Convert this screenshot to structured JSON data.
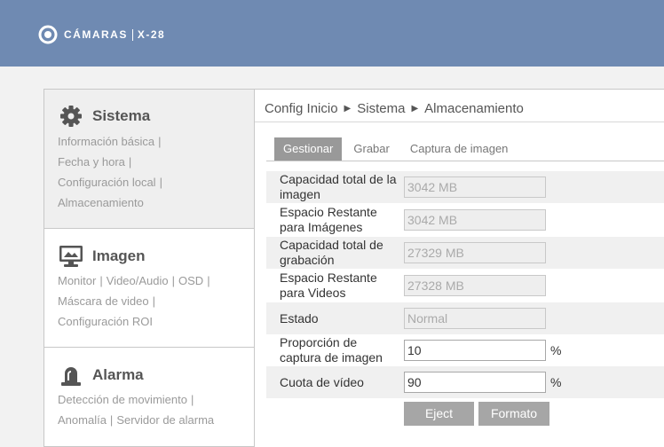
{
  "header": {
    "brand": "CÁMARAS",
    "model": "X-28"
  },
  "sidebar": {
    "sections": [
      {
        "title": "Sistema",
        "icon": "gear-icon",
        "links": [
          "Información básica",
          "Fecha y hora",
          "Configuración local",
          "Almacenamiento"
        ]
      },
      {
        "title": "Imagen",
        "icon": "monitor-icon",
        "links": [
          "Monitor",
          "Video/Audio",
          "OSD",
          "Máscara de video",
          "Configuración ROI"
        ]
      },
      {
        "title": "Alarma",
        "icon": "siren-icon",
        "links": [
          "Detección de movimiento",
          "Anomalía",
          "Servidor de alarma"
        ]
      }
    ]
  },
  "main": {
    "breadcrumb": [
      "Config Inicio",
      "Sistema",
      "Almacenamiento"
    ],
    "tabs": [
      "Gestionar",
      "Grabar",
      "Captura de imagen"
    ],
    "active_tab": "Gestionar",
    "fields": [
      {
        "label": "Capacidad total de la imagen",
        "value": "3042 MB",
        "editable": false
      },
      {
        "label": "Espacio Restante para Imágenes",
        "value": "3042 MB",
        "editable": false
      },
      {
        "label": "Capacidad total de grabación",
        "value": "27329 MB",
        "editable": false
      },
      {
        "label": "Espacio Restante para Videos",
        "value": "27328 MB",
        "editable": false
      },
      {
        "label": "Estado",
        "value": "Normal",
        "editable": false
      },
      {
        "label": "Proporción de captura de imagen",
        "value": "10",
        "editable": true,
        "unit": "%"
      },
      {
        "label": "Cuota de vídeo",
        "value": "90",
        "editable": true,
        "unit": "%"
      }
    ],
    "buttons": {
      "eject": "Eject",
      "format": "Formato"
    }
  },
  "colors": {
    "header_bg": "#6f8ab2",
    "active_tab_bg": "#999999",
    "button_bg": "#a6a6a6"
  }
}
